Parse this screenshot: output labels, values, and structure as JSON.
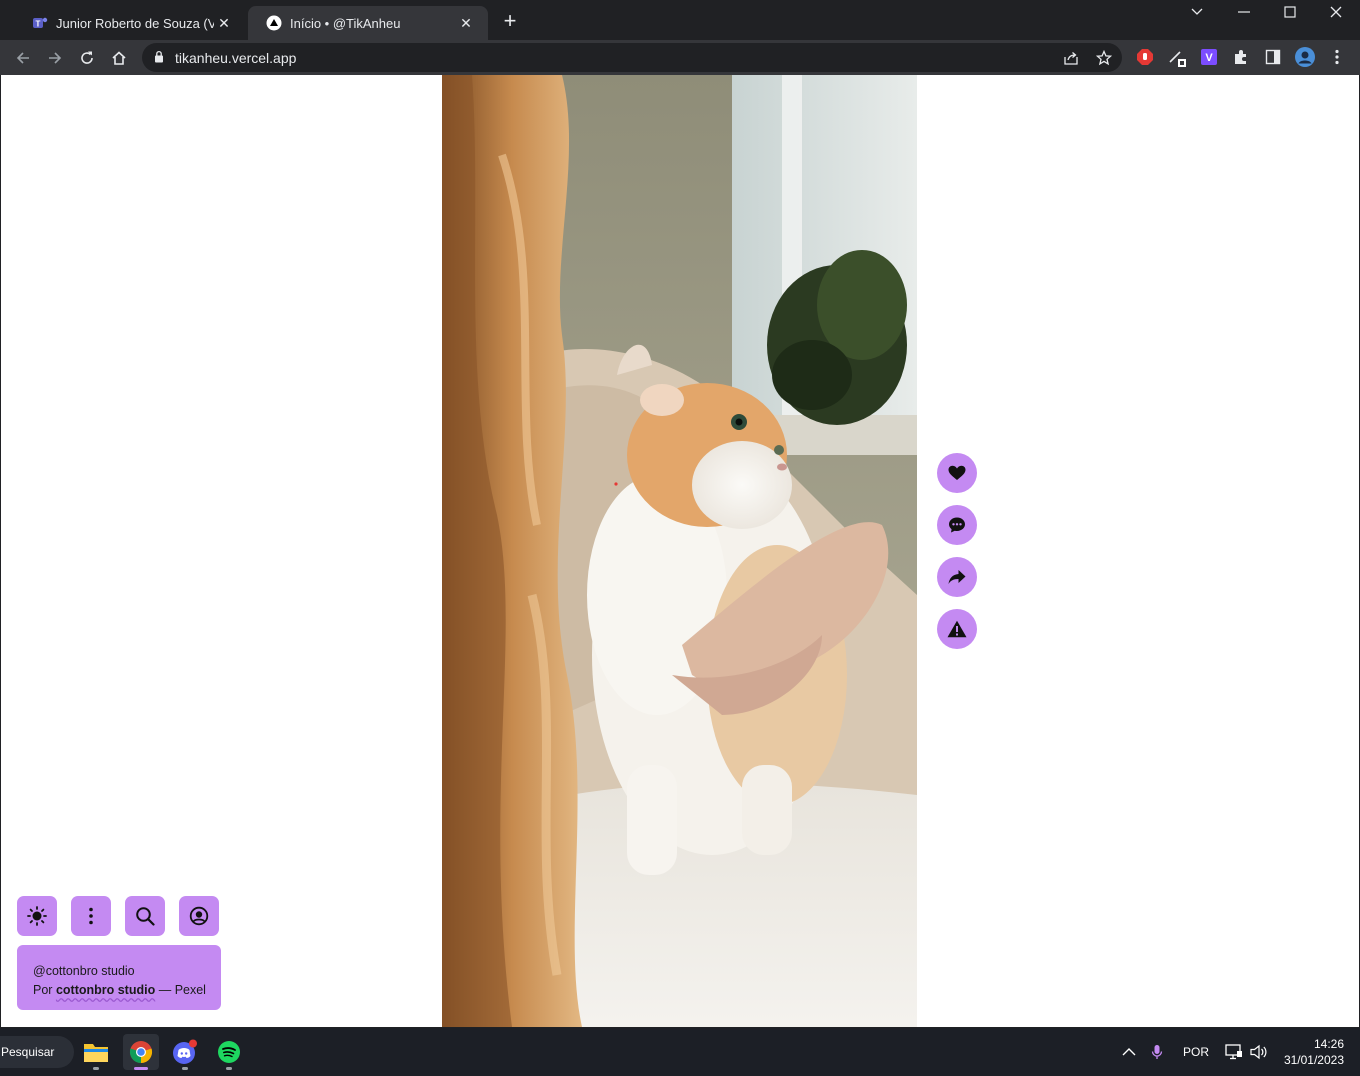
{
  "browser": {
    "tabs": [
      {
        "title": "Junior Roberto de Souza (Você) |",
        "favicon": "teams-icon",
        "active": false
      },
      {
        "title": "Início • @TikAnheu",
        "favicon": "vercel-icon",
        "active": true
      }
    ],
    "url": "tikanheu.vercel.app"
  },
  "video": {
    "description": "cat being held by woman"
  },
  "actions": [
    {
      "name": "like-button",
      "icon": "heart-icon"
    },
    {
      "name": "comment-button",
      "icon": "comment-icon"
    },
    {
      "name": "share-button",
      "icon": "share-icon"
    },
    {
      "name": "report-button",
      "icon": "warning-icon"
    }
  ],
  "tools": [
    {
      "name": "theme-toggle-button",
      "icon": "sun-icon"
    },
    {
      "name": "more-options-button",
      "icon": "kebab-menu-icon"
    },
    {
      "name": "search-button",
      "icon": "search-icon"
    },
    {
      "name": "profile-button",
      "icon": "user-circle-icon"
    }
  ],
  "credit": {
    "handle": "@cottonbro studio",
    "prefix": "Por",
    "author": "cottonbro studio",
    "suffix": "— Pexel"
  },
  "taskbar": {
    "search_label": "Pesquisar",
    "language": "POR",
    "time": "14:26",
    "date": "31/01/2023"
  },
  "colors": {
    "accent": "#c48af2",
    "browser_dark": "#202124",
    "browser_toolbar": "#35363a",
    "taskbar": "#1c1f26"
  }
}
